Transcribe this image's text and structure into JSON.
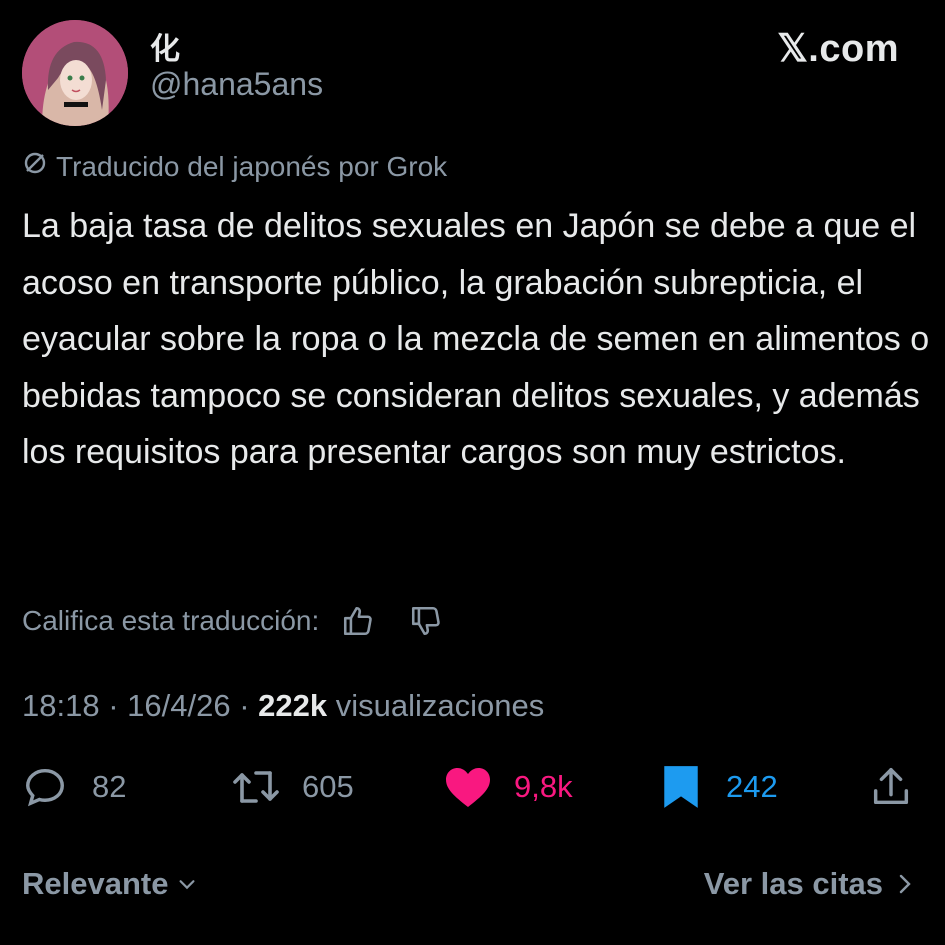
{
  "author": {
    "display_name": "化",
    "handle": "@hana5ans"
  },
  "brand": {
    "logo_text": "𝕏.com"
  },
  "translation": {
    "notice": "Traducido del japonés por Grok",
    "rate_label": "Califica esta traducción:"
  },
  "tweet": {
    "text": "La baja tasa de delitos sexuales en Japón se debe a que el acoso en transporte público, la grabación subrepticia, el eyacular sobre la ropa o la mezcla de semen en alimentos o bebidas tampoco se consideran delitos sexuales, y además los requisitos para presentar cargos son muy estrictos."
  },
  "meta": {
    "time": "18:18",
    "sep1": " · ",
    "date": "16/4/26",
    "sep2": " · ",
    "views": "222k",
    "views_label": " visualizaciones"
  },
  "actions": {
    "replies": "82",
    "reposts": "605",
    "likes": "9,8k",
    "bookmarks": "242"
  },
  "colors": {
    "like": "#f91880",
    "bookmark": "#1d9bf0",
    "muted": "#8b98a5",
    "text": "#e7e9ea"
  },
  "footer": {
    "sort_label": "Relevante",
    "quotes_label": "Ver las citas"
  }
}
